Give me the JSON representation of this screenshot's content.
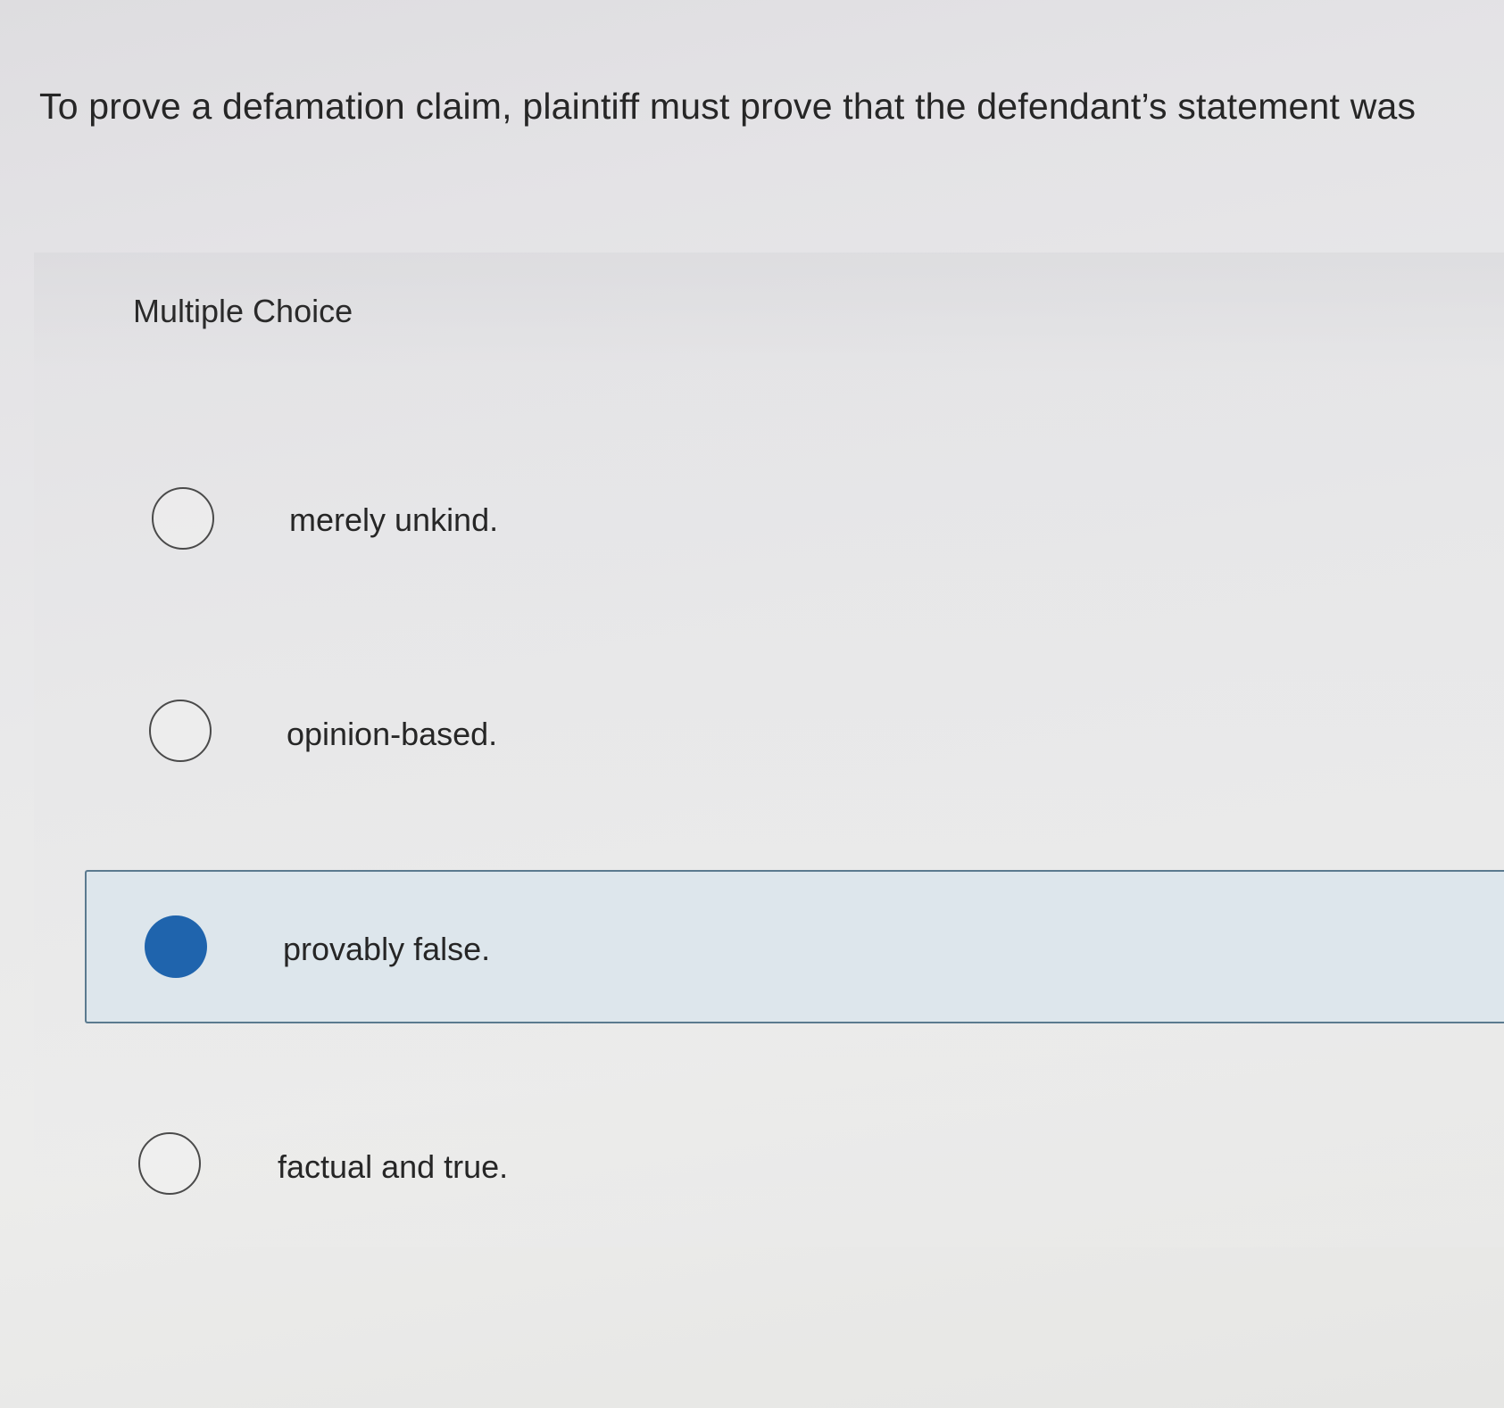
{
  "question": {
    "text": "To prove a defamation claim, plaintiff must prove that the defendant’s statement was"
  },
  "quiz": {
    "type_label": "Multiple Choice",
    "options": [
      {
        "label": "merely unkind.",
        "selected": false
      },
      {
        "label": "opinion-based.",
        "selected": false
      },
      {
        "label": "provably false.",
        "selected": true
      },
      {
        "label": "factual and true.",
        "selected": false
      }
    ]
  },
  "colors": {
    "accent": "#1f64ad",
    "selected_background": "#d8e4ec",
    "selected_border": "#5b7a8f"
  }
}
